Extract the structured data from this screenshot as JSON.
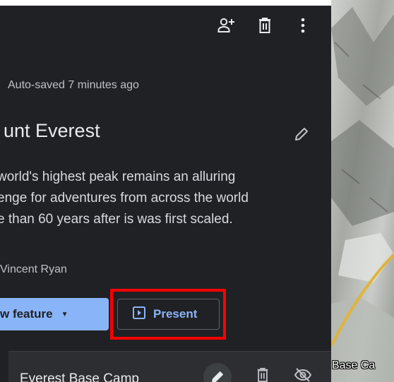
{
  "header": {
    "add_person_icon": "person-add-icon",
    "delete_icon": "trash-icon",
    "more_icon": "more-vert-icon"
  },
  "project": {
    "autosave_text": "Auto-saved 7 minutes ago",
    "title": "unt Everest",
    "description_lines": [
      "world's highest peak remains an alluring",
      "enge for adventures from across the world",
      "e than 60 years after is was first scaled."
    ],
    "author": "Vincent Ryan"
  },
  "actions": {
    "add_feature_label": "w feature",
    "present_label": "Present"
  },
  "list": {
    "items": [
      {
        "label": "Everest Base Camp"
      }
    ]
  },
  "map": {
    "label": "t Base Ca"
  },
  "colors": {
    "panel_bg": "#202124",
    "accent": "#8ab4f8",
    "highlight": "#ff0000"
  }
}
